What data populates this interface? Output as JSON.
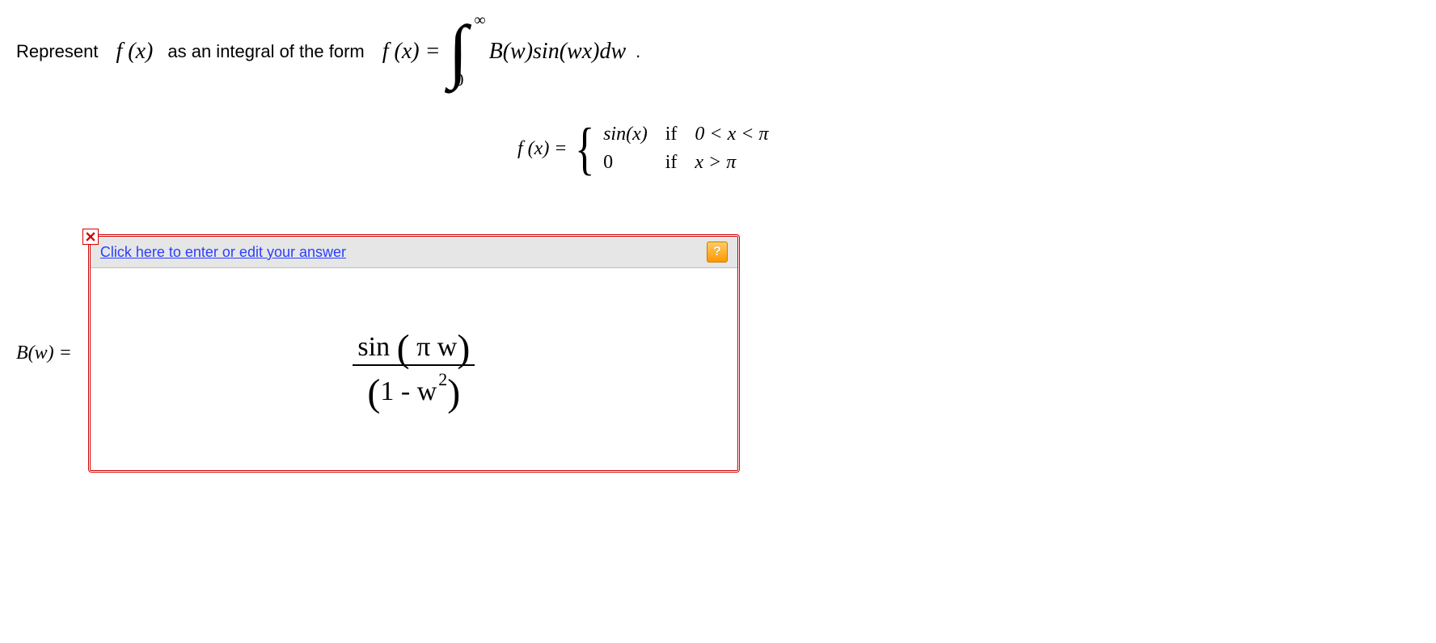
{
  "prompt": {
    "before": "Represent",
    "fx": "f (x)",
    "mid": "as an integral of the form",
    "eq_lhs": "f (x) =",
    "int_upper": "∞",
    "int_lower": "0",
    "integrand": "B(w)sin(wx)dw",
    "period": "."
  },
  "piecewise": {
    "lhs": "f (x) =",
    "r1_val": "sin(x)",
    "if": "if",
    "r1_cond": "0 < x < π",
    "r2_val": "0",
    "r2_cond": "x > π"
  },
  "answer": {
    "label_B": "B(w) =",
    "edit_link": "Click here to enter or edit your answer",
    "help": "?",
    "frac_num_sin": "sin",
    "frac_num_arg": " π w",
    "frac_den": "1 -  w",
    "frac_den_exp": "2"
  }
}
